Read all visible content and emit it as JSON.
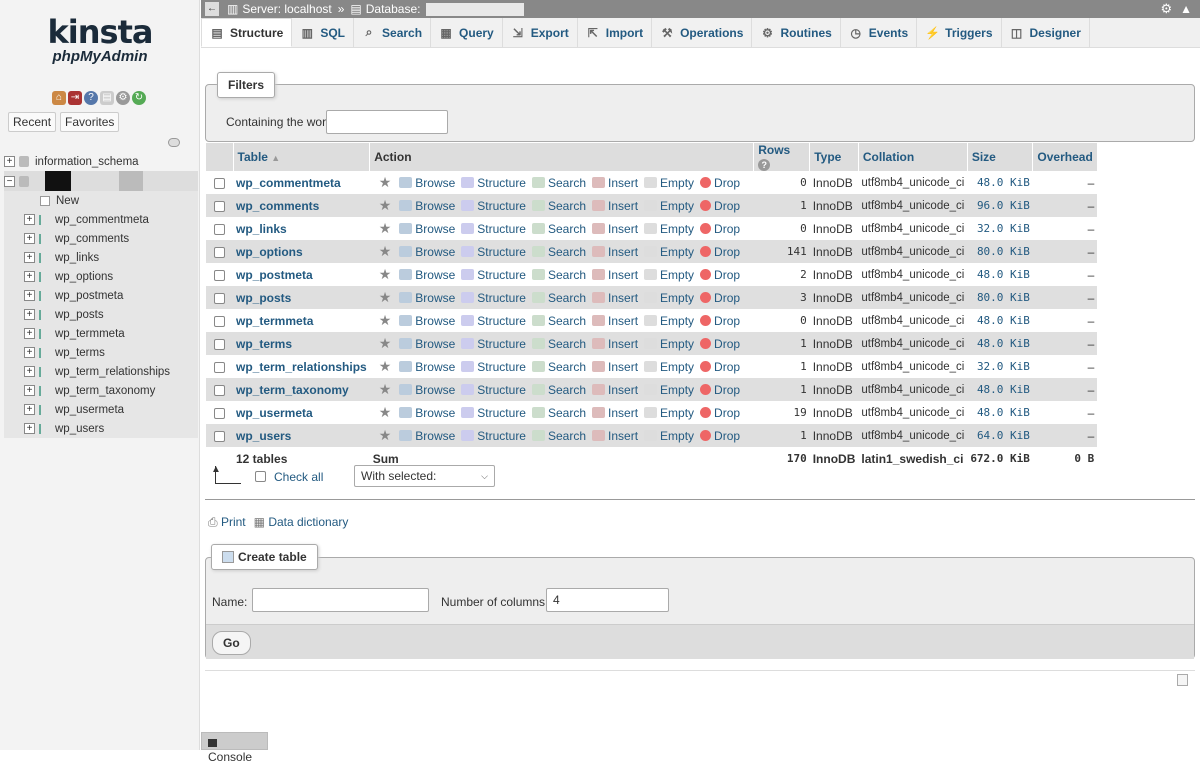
{
  "sidebar": {
    "logo_main": "kinsta",
    "logo_sub": "phpMyAdmin",
    "recent_label": "Recent",
    "favorites_label": "Favorites",
    "databases": [
      {
        "name": "information_schema"
      }
    ],
    "new_label": "New",
    "tables": [
      "wp_commentmeta",
      "wp_comments",
      "wp_links",
      "wp_options",
      "wp_postmeta",
      "wp_posts",
      "wp_termmeta",
      "wp_terms",
      "wp_term_relationships",
      "wp_term_taxonomy",
      "wp_usermeta",
      "wp_users"
    ]
  },
  "topbar": {
    "server_label": "Server: localhost",
    "separator": "»",
    "database_label": "Database:"
  },
  "tabs": [
    {
      "label": "Structure",
      "icon": "structure-icon",
      "active": true
    },
    {
      "label": "SQL",
      "icon": "sql-icon"
    },
    {
      "label": "Search",
      "icon": "search-icon"
    },
    {
      "label": "Query",
      "icon": "query-icon"
    },
    {
      "label": "Export",
      "icon": "export-icon"
    },
    {
      "label": "Import",
      "icon": "import-icon"
    },
    {
      "label": "Operations",
      "icon": "wrench-icon"
    },
    {
      "label": "Routines",
      "icon": "routines-icon"
    },
    {
      "label": "Events",
      "icon": "clock-icon"
    },
    {
      "label": "Triggers",
      "icon": "triggers-icon"
    },
    {
      "label": "Designer",
      "icon": "designer-icon"
    }
  ],
  "filters": {
    "legend": "Filters",
    "containing_label": "Containing the word:",
    "containing_value": ""
  },
  "table": {
    "headers": {
      "table": "Table",
      "action": "Action",
      "rows": "Rows",
      "type": "Type",
      "collation": "Collation",
      "size": "Size",
      "overhead": "Overhead"
    },
    "actions": [
      "Browse",
      "Structure",
      "Search",
      "Insert",
      "Empty",
      "Drop"
    ],
    "rows": [
      {
        "name": "wp_commentmeta",
        "rows": "0",
        "type": "InnoDB",
        "collation": "utf8mb4_unicode_ci",
        "size": "48.0 KiB",
        "overhead": "–"
      },
      {
        "name": "wp_comments",
        "rows": "1",
        "type": "InnoDB",
        "collation": "utf8mb4_unicode_ci",
        "size": "96.0 KiB",
        "overhead": "–"
      },
      {
        "name": "wp_links",
        "rows": "0",
        "type": "InnoDB",
        "collation": "utf8mb4_unicode_ci",
        "size": "32.0 KiB",
        "overhead": "–"
      },
      {
        "name": "wp_options",
        "rows": "141",
        "type": "InnoDB",
        "collation": "utf8mb4_unicode_ci",
        "size": "80.0 KiB",
        "overhead": "–"
      },
      {
        "name": "wp_postmeta",
        "rows": "2",
        "type": "InnoDB",
        "collation": "utf8mb4_unicode_ci",
        "size": "48.0 KiB",
        "overhead": "–"
      },
      {
        "name": "wp_posts",
        "rows": "3",
        "type": "InnoDB",
        "collation": "utf8mb4_unicode_ci",
        "size": "80.0 KiB",
        "overhead": "–"
      },
      {
        "name": "wp_termmeta",
        "rows": "0",
        "type": "InnoDB",
        "collation": "utf8mb4_unicode_ci",
        "size": "48.0 KiB",
        "overhead": "–"
      },
      {
        "name": "wp_terms",
        "rows": "1",
        "type": "InnoDB",
        "collation": "utf8mb4_unicode_ci",
        "size": "48.0 KiB",
        "overhead": "–"
      },
      {
        "name": "wp_term_relationships",
        "rows": "1",
        "type": "InnoDB",
        "collation": "utf8mb4_unicode_ci",
        "size": "32.0 KiB",
        "overhead": "–"
      },
      {
        "name": "wp_term_taxonomy",
        "rows": "1",
        "type": "InnoDB",
        "collation": "utf8mb4_unicode_ci",
        "size": "48.0 KiB",
        "overhead": "–"
      },
      {
        "name": "wp_usermeta",
        "rows": "19",
        "type": "InnoDB",
        "collation": "utf8mb4_unicode_ci",
        "size": "48.0 KiB",
        "overhead": "–"
      },
      {
        "name": "wp_users",
        "rows": "1",
        "type": "InnoDB",
        "collation": "utf8mb4_unicode_ci",
        "size": "64.0 KiB",
        "overhead": "–"
      }
    ],
    "footer": {
      "count": "12 tables",
      "sum": "Sum",
      "rows": "170",
      "type": "InnoDB",
      "collation": "latin1_swedish_ci",
      "size": "672.0 KiB",
      "overhead": "0 B"
    }
  },
  "bulk": {
    "check_all": "Check all",
    "with_selected": "With selected:"
  },
  "links": {
    "print": "Print",
    "data_dictionary": "Data dictionary"
  },
  "create_table": {
    "legend": "Create table",
    "name_label": "Name:",
    "name_value": "",
    "columns_label": "Number of columns:",
    "columns_value": "4",
    "go_label": "Go"
  },
  "console_label": "Console"
}
